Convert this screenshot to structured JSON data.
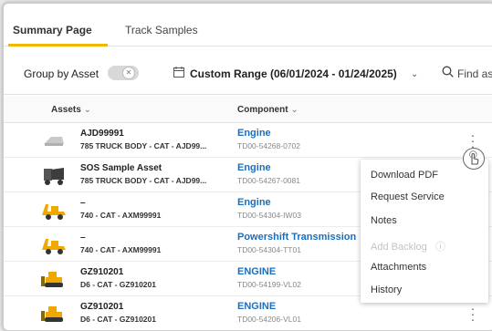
{
  "tabs": [
    {
      "label": "Summary Page",
      "active": true
    },
    {
      "label": "Track Samples",
      "active": false
    }
  ],
  "toolbar": {
    "group_by_label": "Group by Asset",
    "group_by_enabled": false,
    "date_range": "Custom Range (06/01/2024 - 01/24/2025)",
    "search_placeholder": "Find asse"
  },
  "columns": {
    "assets": "Assets",
    "component": "Component"
  },
  "rows": [
    {
      "asset_id": "AJD99991",
      "asset_desc": "785 TRUCK BODY - CAT - AJD99...",
      "component": "Engine",
      "code": "TD00-54268-0702",
      "image": "truck-body-icon"
    },
    {
      "asset_id": "SOS Sample Asset",
      "asset_desc": "785 TRUCK BODY - CAT - AJD99...",
      "component": "Engine",
      "code": "TD00-54267-0081",
      "image": "truck-body-icon"
    },
    {
      "asset_id": "–",
      "asset_desc": "740 - CAT - AXM99991",
      "component": "Engine",
      "code": "TD00-54304-IW03",
      "image": "articulated-truck-icon"
    },
    {
      "asset_id": "–",
      "asset_desc": "740 - CAT - AXM99991",
      "component": "Powershift Transmission",
      "code": "TD00-54304-TT01",
      "image": "articulated-truck-icon"
    },
    {
      "asset_id": "GZ910201",
      "asset_desc": "D6 - CAT - GZ910201",
      "component": "ENGINE",
      "code": "TD00-54199-VL02",
      "image": "dozer-icon"
    },
    {
      "asset_id": "GZ910201",
      "asset_desc": "D6 - CAT - GZ910201",
      "component": "ENGINE",
      "code": "TD00-54206-VL01",
      "image": "dozer-icon"
    }
  ],
  "menu": {
    "items": [
      {
        "label": "Download PDF",
        "enabled": true
      },
      {
        "label": "Request Service",
        "enabled": true
      },
      {
        "label": "Notes",
        "enabled": true
      },
      {
        "label": "Add Backlog",
        "enabled": false
      },
      {
        "label": "Attachments",
        "enabled": true
      },
      {
        "label": "History",
        "enabled": true
      }
    ]
  },
  "colors": {
    "accent_tab": "#f2b800",
    "link": "#1a6fbf",
    "cat_yellow": "#f0a800"
  }
}
